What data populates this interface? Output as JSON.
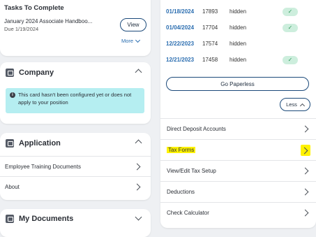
{
  "tasks": {
    "title": "Tasks To Complete",
    "task_name": "January 2024 Associate Handboo...",
    "task_due": "Due 1/19/2024",
    "view_label": "View",
    "more_label": "More"
  },
  "company": {
    "title": "Company",
    "alert_text": "This card hasn't been configured yet or does not apply to your position",
    "info_icon_glyph": "i"
  },
  "application": {
    "title": "Application",
    "items": [
      {
        "label": "Employee Training Documents"
      },
      {
        "label": "About"
      }
    ]
  },
  "documents": {
    "title": "My Documents"
  },
  "payments": {
    "rows": [
      {
        "date": "01/18/2024",
        "number": "17893",
        "amount": "hidden",
        "check": "✓"
      },
      {
        "date": "01/04/2024",
        "number": "17704",
        "amount": "hidden",
        "check": "✓"
      },
      {
        "date": "12/22/2023",
        "number": "17574",
        "amount": "hidden",
        "check": ""
      },
      {
        "date": "12/21/2023",
        "number": "17458",
        "amount": "hidden",
        "check": "✓"
      }
    ],
    "paperless_label": "Go Paperless",
    "less_label": "Less"
  },
  "links": [
    {
      "label": "Direct Deposit Accounts"
    },
    {
      "label": "Tax Forms"
    },
    {
      "label": "View/Edit Tax Setup"
    },
    {
      "label": "Deductions"
    },
    {
      "label": "Check Calculator"
    }
  ],
  "colors": {
    "accent": "#2a6db0",
    "alert_bg": "#b5eef1",
    "highlight": "#fff200",
    "check_bg": "#cdeedd"
  }
}
